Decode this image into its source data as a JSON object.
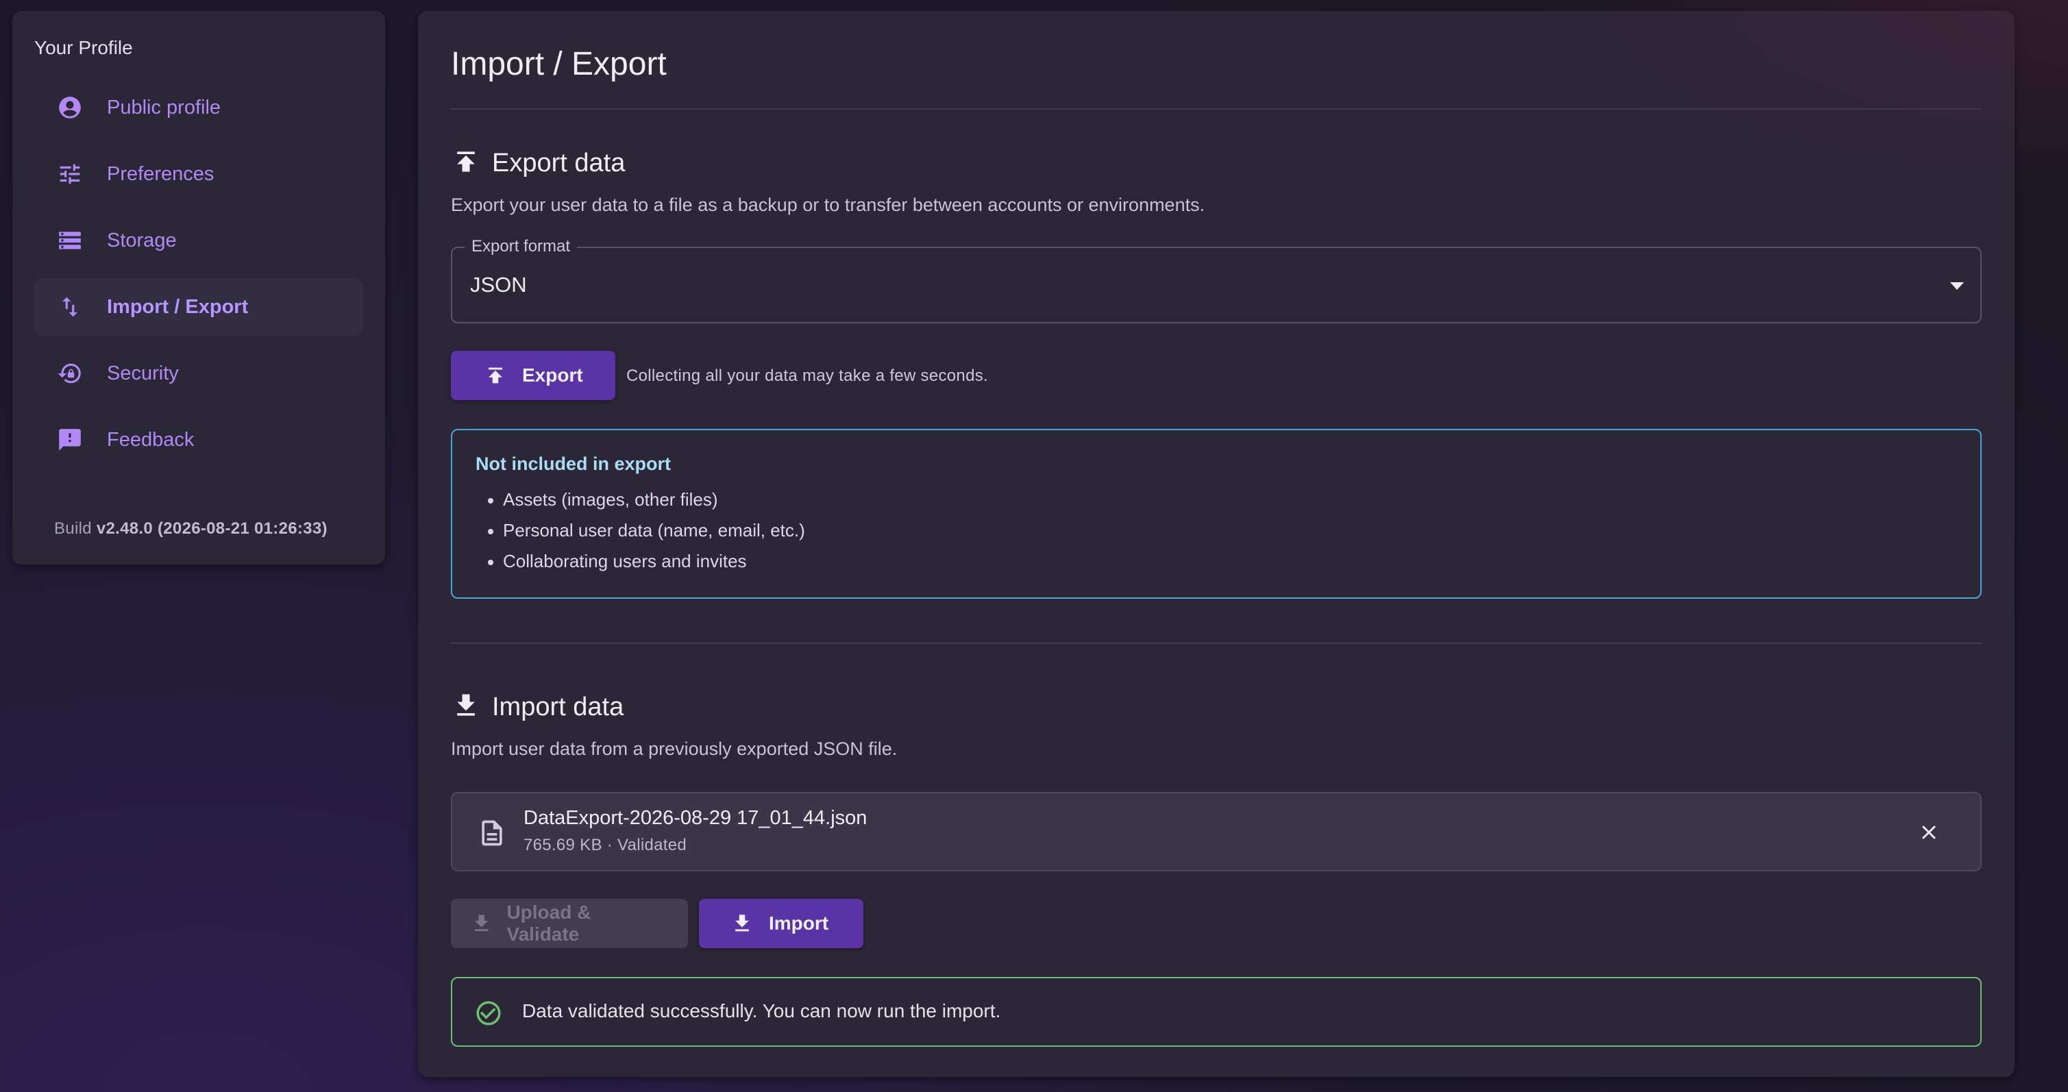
{
  "sidebar": {
    "title": "Your Profile",
    "items": [
      {
        "label": "Public profile",
        "icon": "account-circle-icon"
      },
      {
        "label": "Preferences",
        "icon": "tune-icon"
      },
      {
        "label": "Storage",
        "icon": "storage-icon"
      },
      {
        "label": "Import / Export",
        "icon": "import-export-icon",
        "active": true
      },
      {
        "label": "Security",
        "icon": "lock-reset-icon"
      },
      {
        "label": "Feedback",
        "icon": "feedback-icon"
      }
    ],
    "build_prefix": "Build",
    "build_version": "v2.48.0 (2026-08-21 01:26:33)"
  },
  "main": {
    "title": "Import / Export",
    "export": {
      "title": "Export data",
      "description": "Export your user data to a file as a backup or to transfer between accounts or environments.",
      "format_label": "Export format",
      "format_value": "JSON",
      "button_label": "Export",
      "hint": "Collecting all your data may take a few seconds.",
      "not_included": {
        "title": "Not included in export",
        "items": [
          "Assets (images, other files)",
          "Personal user data (name, email, etc.)",
          "Collaborating users and invites"
        ]
      }
    },
    "import": {
      "title": "Import data",
      "description": "Import user data from a previously exported JSON file.",
      "file_name": "DataExport-2026-08-29 17_01_44.json",
      "file_meta": "765.69 KB · Validated",
      "upload_button_label": "Upload & Validate",
      "import_button_label": "Import",
      "success_message": "Data validated successfully. You can now run the import."
    }
  },
  "colors": {
    "accent": "#b089f4",
    "primary_button": "#5a34a6",
    "info_border": "#4aa6d6",
    "success_border": "#6fbf73"
  }
}
